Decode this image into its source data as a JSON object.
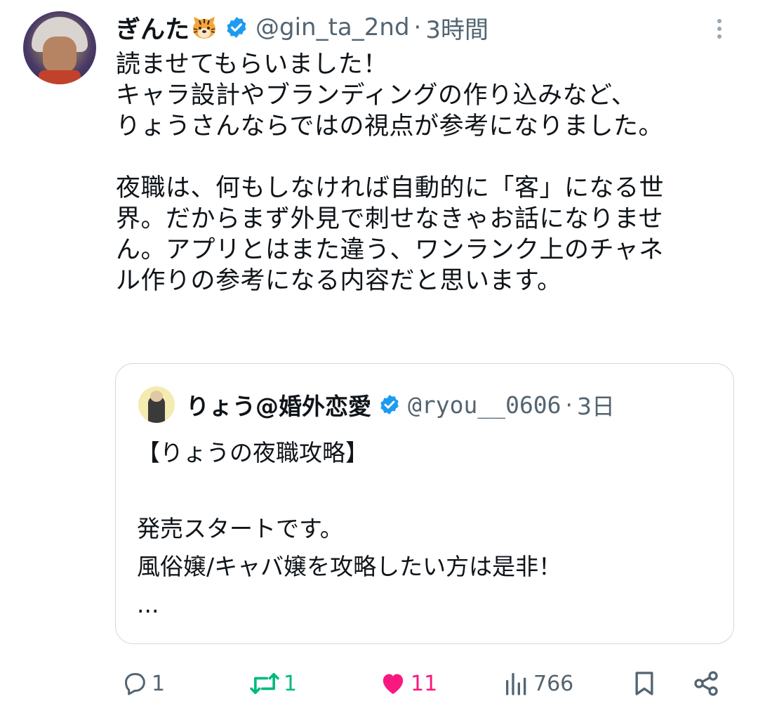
{
  "tweet": {
    "display_name": "ぎんた",
    "name_emoji": "tiger-face",
    "handle": "@gin_ta_2nd",
    "separator": "·",
    "time": "3時間",
    "body_lines_1": [
      "読ませてもらいました！",
      "キャラ設計やブランディングの作り込みなど、",
      "りょうさんならではの視点が参考になりました。"
    ],
    "body_lines_2": [
      "夜職は、何もしなければ自動的に「客」になる世",
      "界。だからまず外見で刺せなきゃお話になりませ",
      "ん。アプリとはまた違う、ワンランク上のチャネ",
      "ル作りの参考になる内容だと思います。"
    ]
  },
  "quoted": {
    "display_name": "りょう@婚外恋愛",
    "handle": "@ryou__0606",
    "separator": "·",
    "time": "3日",
    "title": "【りょうの夜職攻略】",
    "lines": [
      "発売スタートです。",
      "風俗嬢/キャバ嬢を攻略したい方は是非！",
      "..."
    ]
  },
  "actions": {
    "reply_count": "1",
    "retweet_count": "1",
    "like_count": "11",
    "view_count": "766"
  },
  "colors": {
    "text": "#0f1419",
    "secondary": "#536471",
    "verified": "#1d9bf0",
    "retweet": "#00ba7c",
    "like": "#f91880",
    "border": "#cfd9de"
  }
}
